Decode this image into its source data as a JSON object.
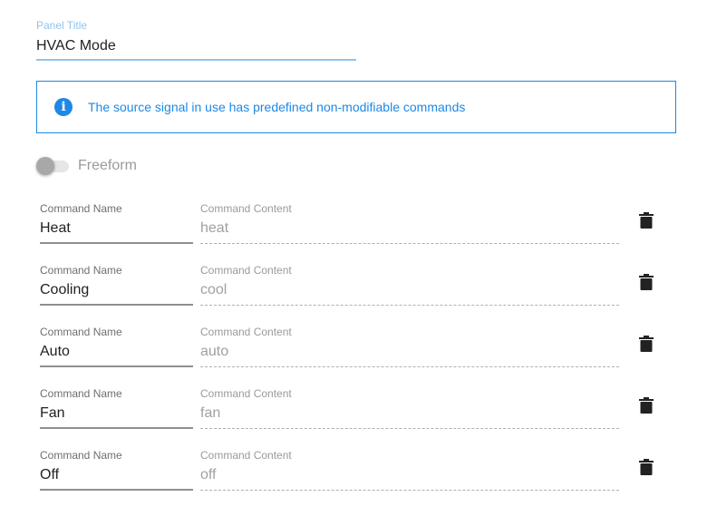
{
  "panel_title": {
    "label": "Panel Title",
    "value": "HVAC Mode"
  },
  "info_banner": {
    "icon": "info-icon",
    "glyph": "i",
    "message": "The source signal in use has predefined non-modifiable commands",
    "color": "#1e88e5"
  },
  "freeform_toggle": {
    "label": "Freeform",
    "checked": false
  },
  "commands": [
    {
      "name_label": "Command Name",
      "name": "Heat",
      "content_label": "Command Content",
      "content": "heat",
      "delete_icon": "trash-icon"
    },
    {
      "name_label": "Command Name",
      "name": "Cooling",
      "content_label": "Command Content",
      "content": "cool",
      "delete_icon": "trash-icon"
    },
    {
      "name_label": "Command Name",
      "name": "Auto",
      "content_label": "Command Content",
      "content": "auto",
      "delete_icon": "trash-icon"
    },
    {
      "name_label": "Command Name",
      "name": "Fan",
      "content_label": "Command Content",
      "content": "fan",
      "delete_icon": "trash-icon"
    },
    {
      "name_label": "Command Name",
      "name": "Off",
      "content_label": "Command Content",
      "content": "off",
      "delete_icon": "trash-icon"
    }
  ]
}
